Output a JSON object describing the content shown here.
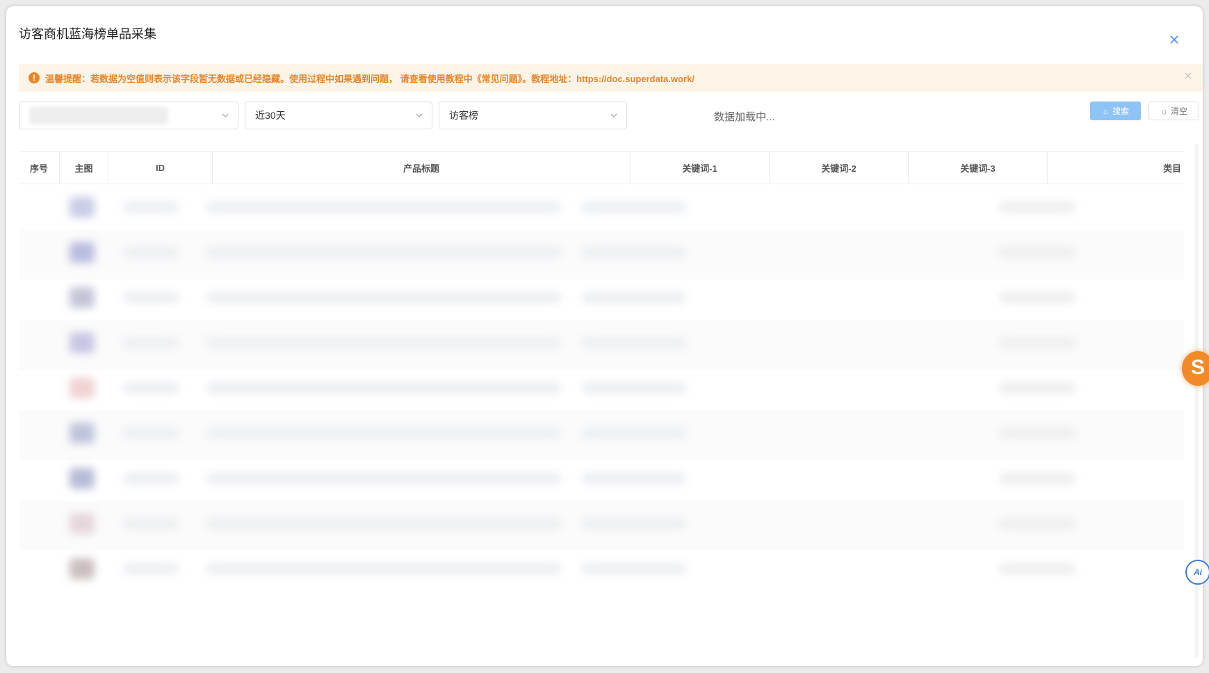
{
  "dialog": {
    "title": "访客商机蓝海榜单品采集"
  },
  "alert": {
    "text": "温馨提醒：若数据为空值则表示该字段暂无数据或已经隐藏。使用过程中如果遇到问题， 请查看使用教程中《常见问题》。教程地址：https://doc.superdata.work/"
  },
  "filters": {
    "period": "近30天",
    "rank_type": "访客榜",
    "status": "数据加载中..."
  },
  "buttons": {
    "search": "搜索",
    "clear": "清空"
  },
  "table": {
    "columns": [
      "序号",
      "主图",
      "ID",
      "产品标题",
      "关键词-1",
      "关键词-2",
      "关键词-3",
      "类目"
    ],
    "rows": 9
  },
  "side": {
    "s_badge": "S",
    "ai_badge": "Ai"
  },
  "colors": {
    "accent": "#409eff",
    "warning": "#e6862a",
    "warning_bg": "#fdf4e8"
  }
}
